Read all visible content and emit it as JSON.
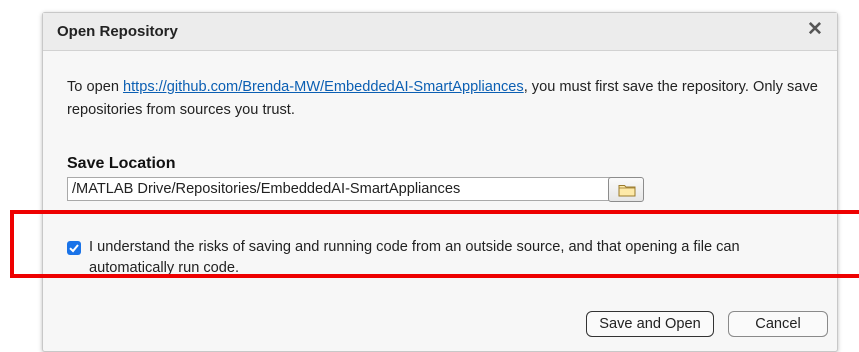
{
  "dialog": {
    "title": "Open Repository",
    "close_glyph": "✕",
    "message_prefix": "To open ",
    "repo_url": "https://github.com/Brenda-MW/EmbeddedAI-SmartAppliances",
    "message_suffix": ", you must first save the repository. Only save repositories from sources you trust.",
    "save_location_label": "Save Location",
    "save_location_value": "/MATLAB Drive/Repositories/EmbeddedAI-SmartAppliances",
    "browse_icon": "folder-icon",
    "risk_checkbox": {
      "checked": true,
      "label": "I understand the risks of saving and running code from an outside source, and that opening a file can automatically run code."
    },
    "save_open_label": "Save and Open",
    "cancel_label": "Cancel"
  },
  "colors": {
    "highlight": "#ee0000",
    "link": "#0b5fb3",
    "checkbox": "#1a73e8"
  }
}
